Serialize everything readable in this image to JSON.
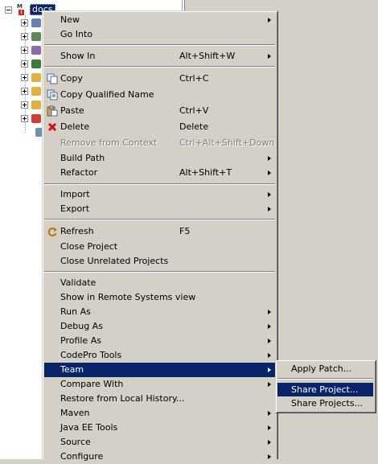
{
  "tree": {
    "root_label": "docs",
    "root_icon": "maven-project-icon",
    "children_icons": [
      "jre-library-icon",
      "web-app-libraries-icon",
      "maven-dependencies-icon",
      "build-icon",
      "folder-icon",
      "folder-icon",
      "folder-icon",
      "error-folder-icon",
      "file-icon"
    ]
  },
  "menu": {
    "items": [
      {
        "label": "New",
        "shortcut": "",
        "submenu": true
      },
      {
        "label": "Go Into",
        "shortcut": "",
        "submenu": false
      },
      {
        "label": "Show In",
        "shortcut": "Alt+Shift+W",
        "submenu": true
      },
      {
        "label": "Copy",
        "shortcut": "Ctrl+C",
        "icon": "copy-icon"
      },
      {
        "label": "Copy Qualified Name",
        "shortcut": "",
        "icon": "copy-qualified-name-icon"
      },
      {
        "label": "Paste",
        "shortcut": "Ctrl+V",
        "icon": "paste-icon"
      },
      {
        "label": "Delete",
        "shortcut": "Delete",
        "icon": "delete-icon"
      },
      {
        "label": "Remove from Context",
        "shortcut": "Ctrl+Alt+Shift+Down",
        "disabled": true
      },
      {
        "label": "Build Path",
        "shortcut": "",
        "submenu": true
      },
      {
        "label": "Refactor",
        "shortcut": "Alt+Shift+T",
        "submenu": true
      },
      {
        "label": "Import",
        "shortcut": "",
        "submenu": true
      },
      {
        "label": "Export",
        "shortcut": "",
        "submenu": true
      },
      {
        "label": "Refresh",
        "shortcut": "F5",
        "icon": "refresh-icon"
      },
      {
        "label": "Close Project",
        "shortcut": ""
      },
      {
        "label": "Close Unrelated Projects",
        "shortcut": ""
      },
      {
        "label": "Validate",
        "shortcut": ""
      },
      {
        "label": "Show in Remote Systems view",
        "shortcut": ""
      },
      {
        "label": "Run As",
        "shortcut": "",
        "submenu": true
      },
      {
        "label": "Debug As",
        "shortcut": "",
        "submenu": true
      },
      {
        "label": "Profile As",
        "shortcut": "",
        "submenu": true
      },
      {
        "label": "CodePro Tools",
        "shortcut": "",
        "submenu": true
      },
      {
        "label": "Team",
        "shortcut": "",
        "submenu": true,
        "highlighted": true
      },
      {
        "label": "Compare With",
        "shortcut": "",
        "submenu": true
      },
      {
        "label": "Restore from Local History...",
        "shortcut": ""
      },
      {
        "label": "Maven",
        "shortcut": "",
        "submenu": true
      },
      {
        "label": "Java EE Tools",
        "shortcut": "",
        "submenu": true
      },
      {
        "label": "Source",
        "shortcut": "",
        "submenu": true
      },
      {
        "label": "Configure",
        "shortcut": "",
        "submenu": true
      }
    ]
  },
  "team_submenu": {
    "items": [
      {
        "label": "Apply Patch..."
      },
      {
        "label": "Share Project...",
        "highlighted": true
      },
      {
        "label": "Share Projects..."
      }
    ]
  },
  "colors": {
    "highlight": "#0a246a",
    "menu_bg": "#d4d0c8"
  }
}
